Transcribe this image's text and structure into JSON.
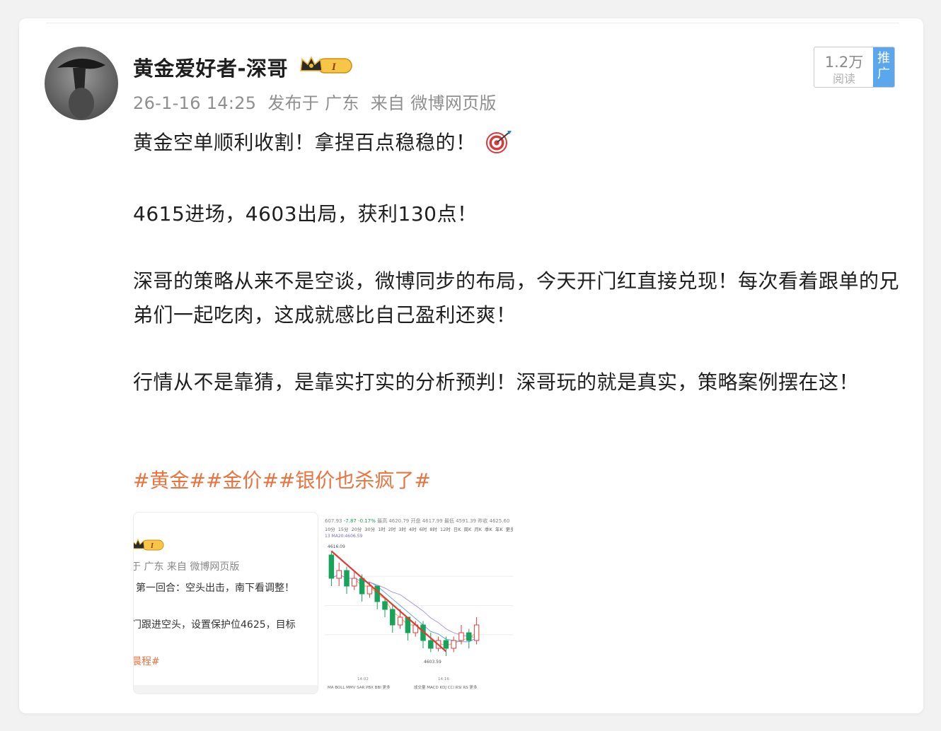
{
  "user": {
    "name": "黄金爱好者-深哥",
    "level_badge": "I",
    "time": "26-1-16 14:25",
    "location": "发布于 广东",
    "source": "来自 微博网页版"
  },
  "read_badge": {
    "count": "1.2万",
    "label": "阅读",
    "promo": "推广"
  },
  "post": {
    "paragraphs": [
      "黄金空单顺利收割！拿捏百点稳稳的！",
      "4615进场，4603出局，获利130点！",
      "深哥的策略从来不是空谈，微博同步的布局，今天开门红直接兑现！每次看着跟单的兄弟们一起吃肉，这成就感比自己盈利还爽！",
      "行情从不是靠猜，是靠实打实的分析预判！深哥玩的就是真实，策略案例摆在这！"
    ],
    "hashtags": [
      "#黄金#",
      "#金价#",
      "#银价也杀疯了#"
    ]
  },
  "thumb1": {
    "meta": "于 广东 来自 微博网页版",
    "line2": "第一回合：空头出击，南下看调整！",
    "line3": "门跟进空头，设置保护位4625，目标",
    "tag": "晨程#"
  },
  "thumb2": {
    "head_price": "607.93",
    "head_change": "-7.87",
    "head_pct": "-0.17%",
    "head_rest": "最高 4620.79  开盘 4617.99  最低 4591.39  昨收 4625.60",
    "tabs": [
      "10分",
      "15分",
      "20分",
      "30分",
      "1时",
      "2时",
      "3时",
      "4时",
      "6时",
      "8时",
      "12时",
      "日K",
      "周K",
      "月K",
      "季K",
      "年K",
      "更多"
    ],
    "ma": "13  MA20:4606.59",
    "high_label": "4616.09",
    "low_label": "4603.59",
    "time1": "14:02",
    "time2": "14:16",
    "indicators_left": "MA  BOLL  MMV  SAR  PBX  BBI  更多",
    "indicators_right": "成交量  MACD  KDJ  CCI  RSI  RS  更多"
  },
  "colors": {
    "hashtag": "#eb7340",
    "promo": "#5aa7ee",
    "candle_up": "#e23b3b",
    "candle_down": "#17a35a"
  },
  "chart_data": {
    "type": "candlestick",
    "series": [
      {
        "o": 4616,
        "c": 4613,
        "h": 4616.5,
        "l": 4612
      },
      {
        "o": 4613,
        "c": 4614,
        "h": 4615,
        "l": 4612
      },
      {
        "o": 4614,
        "c": 4612,
        "h": 4614.5,
        "l": 4611
      },
      {
        "o": 4612,
        "c": 4613,
        "h": 4614,
        "l": 4611.5
      },
      {
        "o": 4613,
        "c": 4611,
        "h": 4613.5,
        "l": 4610
      },
      {
        "o": 4611,
        "c": 4612,
        "h": 4612.5,
        "l": 4610.5
      },
      {
        "o": 4612,
        "c": 4610,
        "h": 4612,
        "l": 4609
      },
      {
        "o": 4610,
        "c": 4609,
        "h": 4610.5,
        "l": 4608
      },
      {
        "o": 4609,
        "c": 4607,
        "h": 4609.5,
        "l": 4606
      },
      {
        "o": 4607,
        "c": 4608,
        "h": 4609,
        "l": 4606.5
      },
      {
        "o": 4608,
        "c": 4606,
        "h": 4608,
        "l": 4605
      },
      {
        "o": 4606,
        "c": 4607,
        "h": 4607.5,
        "l": 4605.5
      },
      {
        "o": 4607,
        "c": 4605,
        "h": 4607.5,
        "l": 4604
      },
      {
        "o": 4605,
        "c": 4604,
        "h": 4606,
        "l": 4603.5
      },
      {
        "o": 4604,
        "c": 4605,
        "h": 4605.5,
        "l": 4603.6
      },
      {
        "o": 4605,
        "c": 4604,
        "h": 4605.5,
        "l": 4603
      },
      {
        "o": 4604,
        "c": 4605,
        "h": 4605.5,
        "l": 4603.5
      },
      {
        "o": 4605,
        "c": 4606,
        "h": 4607,
        "l": 4604.5
      },
      {
        "o": 4606,
        "c": 4605,
        "h": 4606.5,
        "l": 4604
      },
      {
        "o": 4605,
        "c": 4607,
        "h": 4608,
        "l": 4604.5
      }
    ],
    "ylim": [
      4602,
      4617
    ],
    "trendline": [
      [
        0,
        4616.5
      ],
      [
        15,
        4603.6
      ]
    ]
  }
}
